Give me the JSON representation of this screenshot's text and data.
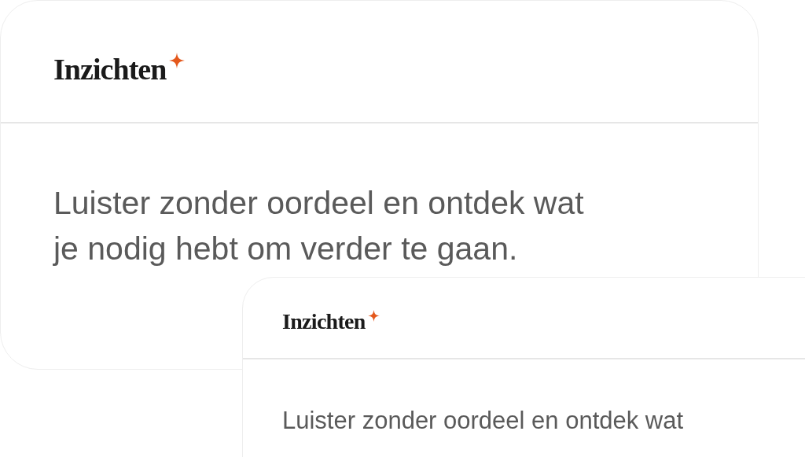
{
  "cards": [
    {
      "title": "Inzichten",
      "lines": [
        "Luister zonder oordeel en ontdek wat",
        "je nodig hebt om verder te gaan."
      ]
    },
    {
      "title": "Inzichten",
      "lines": [
        "Luister zonder oordeel en ontdek wat"
      ]
    }
  ]
}
